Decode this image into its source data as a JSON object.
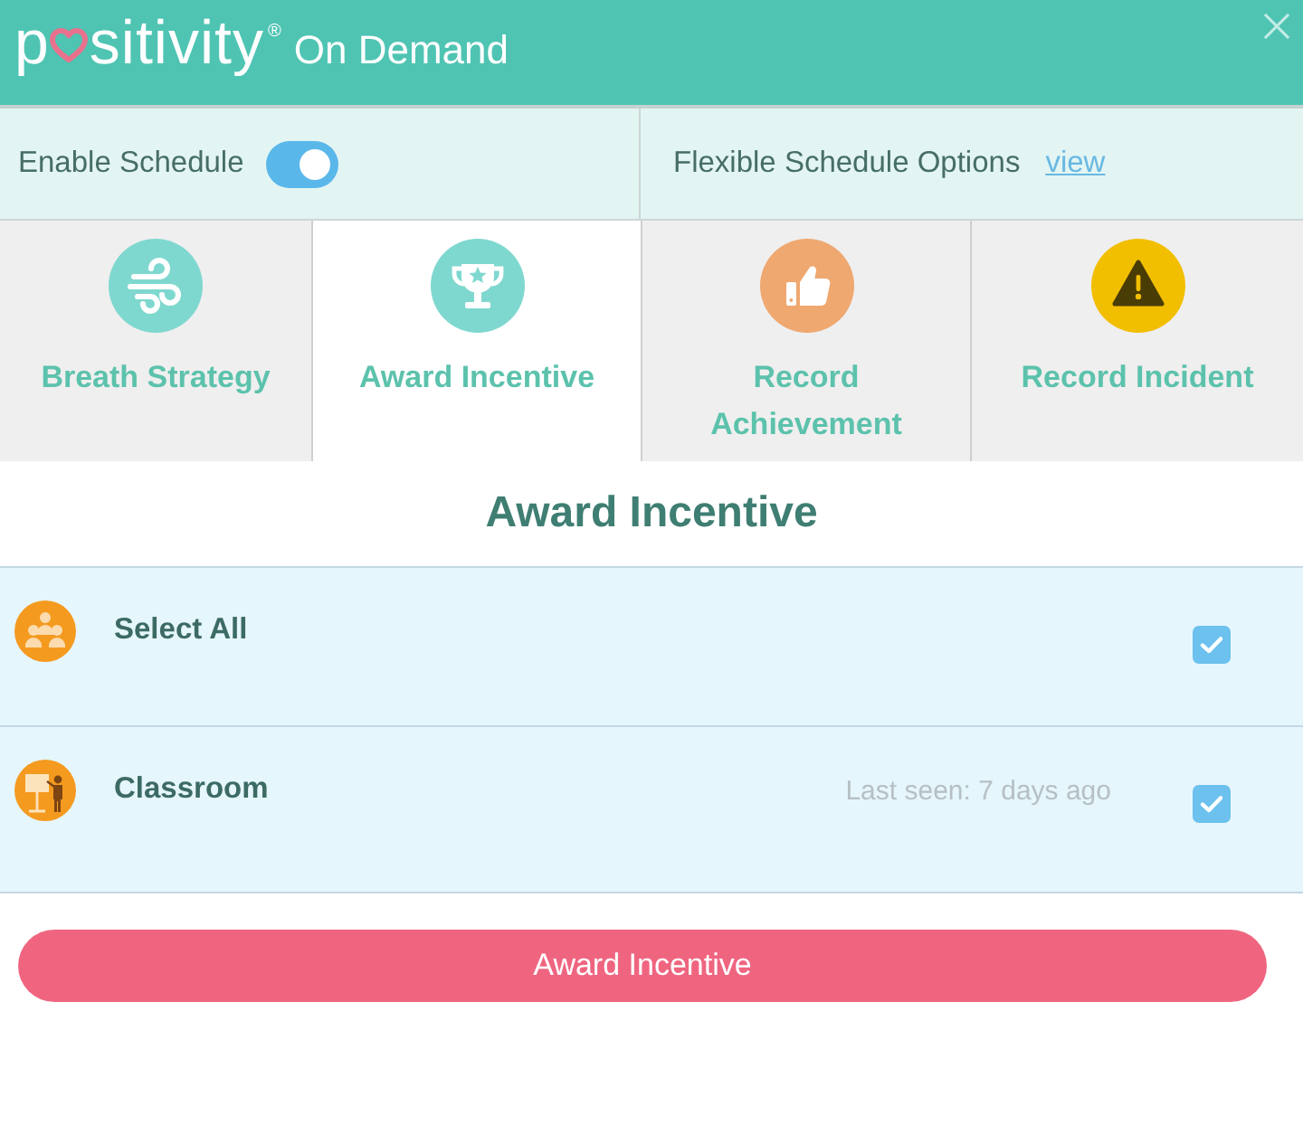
{
  "header": {
    "logo": {
      "start": "p",
      "end": "sitivity",
      "registered": "®"
    },
    "subtitle": "On Demand"
  },
  "settings": {
    "schedule": {
      "label": "Enable Schedule",
      "on": true
    },
    "flexible": {
      "label": "Flexible Schedule Options",
      "link": "view"
    }
  },
  "tabs": [
    {
      "label": "Breath Strategy",
      "kind": "wind",
      "selected": false
    },
    {
      "label": "Award Incentive",
      "kind": "trophy",
      "selected": true
    },
    {
      "label": "Record Achievement",
      "kind": "thumbs_up",
      "selected": false
    },
    {
      "label": "Record Incident",
      "kind": "warning",
      "selected": false
    }
  ],
  "panel": {
    "title": "Award Incentive",
    "rows": [
      {
        "name": "Select All",
        "kind": "group",
        "checked": true
      },
      {
        "name": "Classroom",
        "kind": "classroom",
        "last_seen": "Last seen: 7 days ago",
        "checked": true
      }
    ],
    "button": "Award Incentive"
  }
}
